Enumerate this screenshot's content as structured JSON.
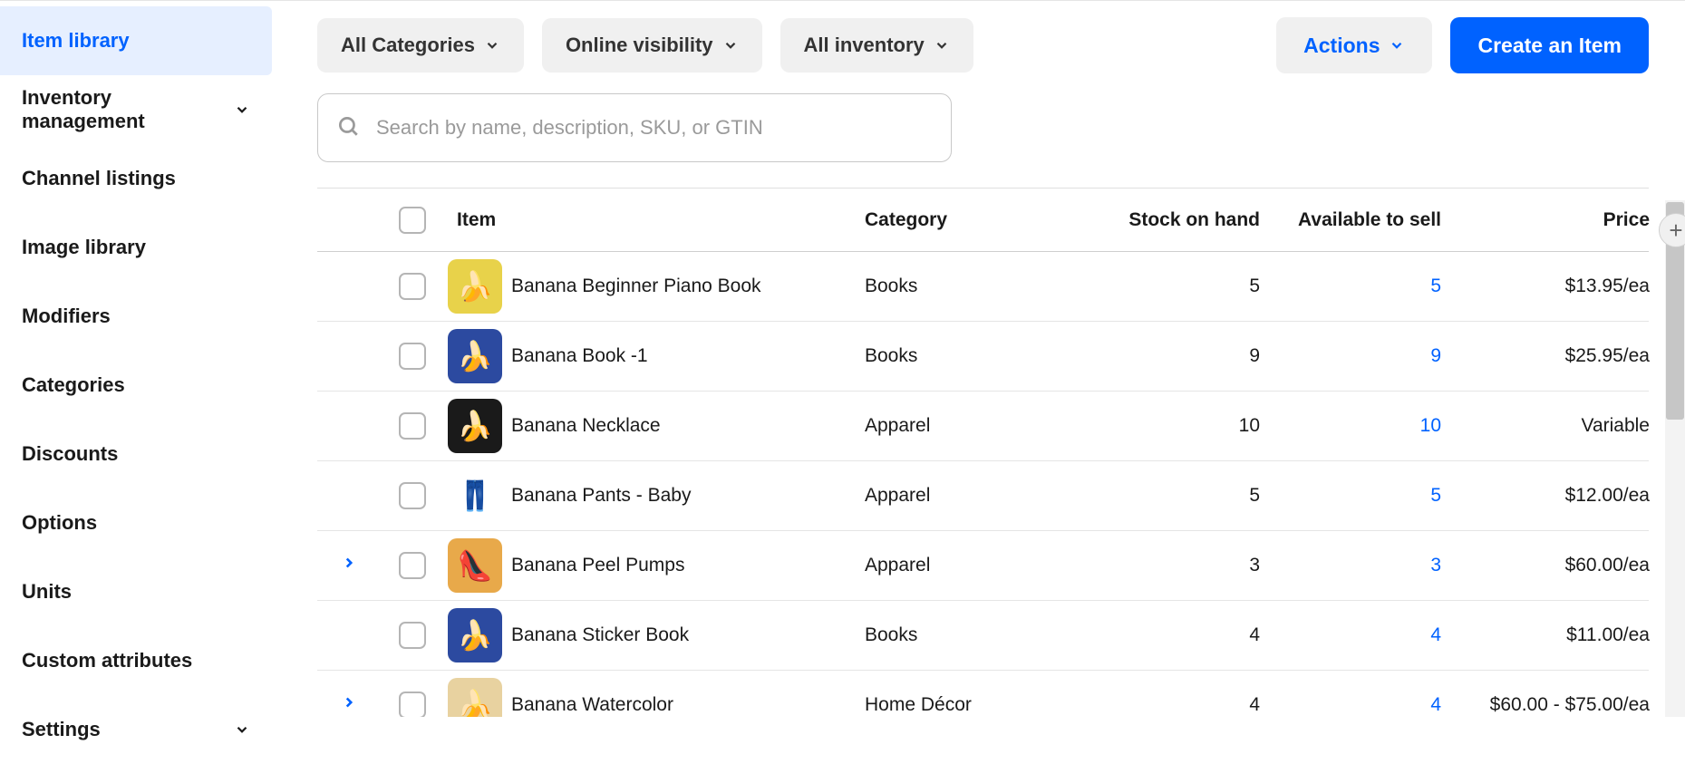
{
  "sidebar": {
    "items": [
      {
        "label": "Item library",
        "active": true,
        "chevron": false
      },
      {
        "label": "Inventory management",
        "active": false,
        "chevron": true
      },
      {
        "label": "Channel listings",
        "active": false,
        "chevron": false
      },
      {
        "label": "Image library",
        "active": false,
        "chevron": false
      },
      {
        "label": "Modifiers",
        "active": false,
        "chevron": false
      },
      {
        "label": "Categories",
        "active": false,
        "chevron": false
      },
      {
        "label": "Discounts",
        "active": false,
        "chevron": false
      },
      {
        "label": "Options",
        "active": false,
        "chevron": false
      },
      {
        "label": "Units",
        "active": false,
        "chevron": false
      },
      {
        "label": "Custom attributes",
        "active": false,
        "chevron": false
      },
      {
        "label": "Settings",
        "active": false,
        "chevron": true
      }
    ]
  },
  "toolbar": {
    "filters": {
      "categories": "All Categories",
      "visibility": "Online visibility",
      "inventory": "All inventory"
    },
    "actions_label": "Actions",
    "create_label": "Create an Item"
  },
  "search": {
    "placeholder": "Search by name, description, SKU, or GTIN"
  },
  "table": {
    "headers": {
      "item": "Item",
      "category": "Category",
      "stock": "Stock on hand",
      "available": "Available to sell",
      "price": "Price"
    },
    "rows": [
      {
        "name": "Banana Beginner Piano Book",
        "category": "Books",
        "stock": "5",
        "available": "5",
        "price": "$13.95/ea",
        "expandable": false,
        "thumb_bg": "#e8d24a",
        "thumb_emoji": "🍌"
      },
      {
        "name": "Banana Book -1",
        "category": "Books",
        "stock": "9",
        "available": "9",
        "price": "$25.95/ea",
        "expandable": false,
        "thumb_bg": "#2c4aa0",
        "thumb_emoji": "🍌"
      },
      {
        "name": "Banana Necklace",
        "category": "Apparel",
        "stock": "10",
        "available": "10",
        "price": "Variable",
        "expandable": false,
        "thumb_bg": "#1a1a1a",
        "thumb_emoji": "🍌"
      },
      {
        "name": "Banana Pants - Baby",
        "category": "Apparel",
        "stock": "5",
        "available": "5",
        "price": "$12.00/ea",
        "expandable": false,
        "thumb_bg": "#ffffff",
        "thumb_emoji": "👖"
      },
      {
        "name": "Banana Peel Pumps",
        "category": "Apparel",
        "stock": "3",
        "available": "3",
        "price": "$60.00/ea",
        "expandable": true,
        "thumb_bg": "#e8a94a",
        "thumb_emoji": "👠"
      },
      {
        "name": "Banana Sticker Book",
        "category": "Books",
        "stock": "4",
        "available": "4",
        "price": "$11.00/ea",
        "expandable": false,
        "thumb_bg": "#2c4aa0",
        "thumb_emoji": "🍌"
      },
      {
        "name": "Banana Watercolor",
        "category": "Home Décor",
        "stock": "4",
        "available": "4",
        "price": "$60.00 - $75.00/ea",
        "expandable": true,
        "thumb_bg": "#e8d2a0",
        "thumb_emoji": "🍌"
      }
    ]
  }
}
